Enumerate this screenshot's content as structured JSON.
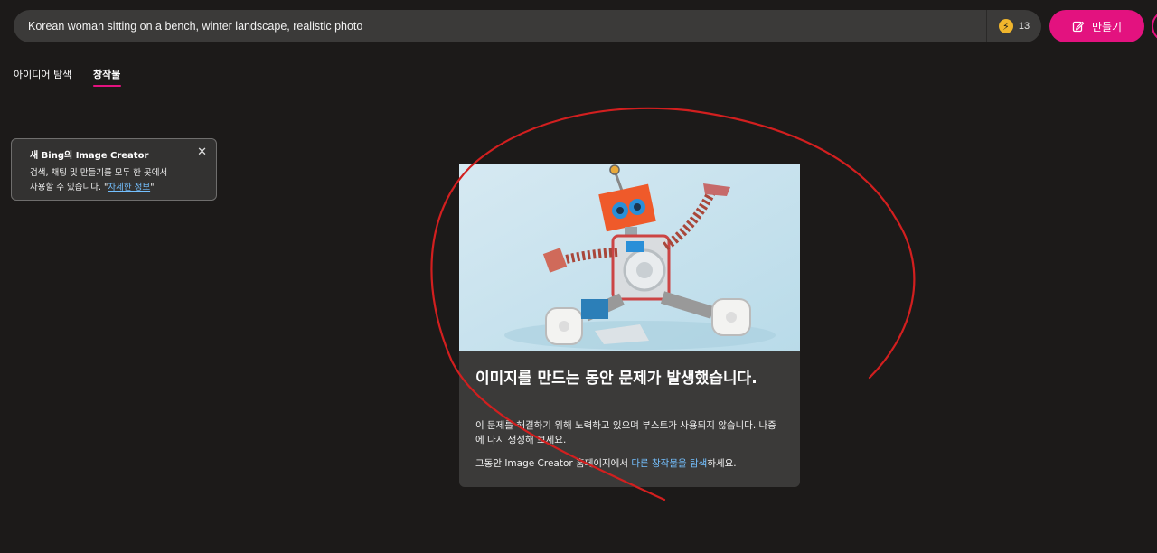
{
  "search": {
    "value": "Korean woman sitting on a bench, winter landscape, realistic photo",
    "boost_count": "13",
    "create_label": "만들기"
  },
  "tabs": [
    {
      "label": "아이디어 탐색"
    },
    {
      "label": "창작물"
    }
  ],
  "tooltip": {
    "title": "새 Bing의 Image Creator",
    "text_line1": "검색, 채팅 및 만들기를 모두 한 곳에서",
    "text_line2_prefix": "사용할 수 있습니다. \"",
    "link": "자세한 정보",
    "text_line2_suffix": "\""
  },
  "error_card": {
    "title": "이미지를 만드는 동안 문제가 발생했습니다.",
    "message": "이 문제를 해결하기 위해 노력하고 있으며 부스트가 사용되지 않습니다. 나중에 다시 생성해 보세요.",
    "explore_prefix": "그동안 Image Creator 홈페이지에서 ",
    "explore_link": "다른 창작물을 탐색",
    "explore_suffix": "하세요."
  },
  "colors": {
    "accent": "#e3127f",
    "link": "#74c0ff",
    "annotation": "#d21f1f"
  },
  "icons": [
    "bolt-icon",
    "create-icon",
    "close-icon"
  ]
}
